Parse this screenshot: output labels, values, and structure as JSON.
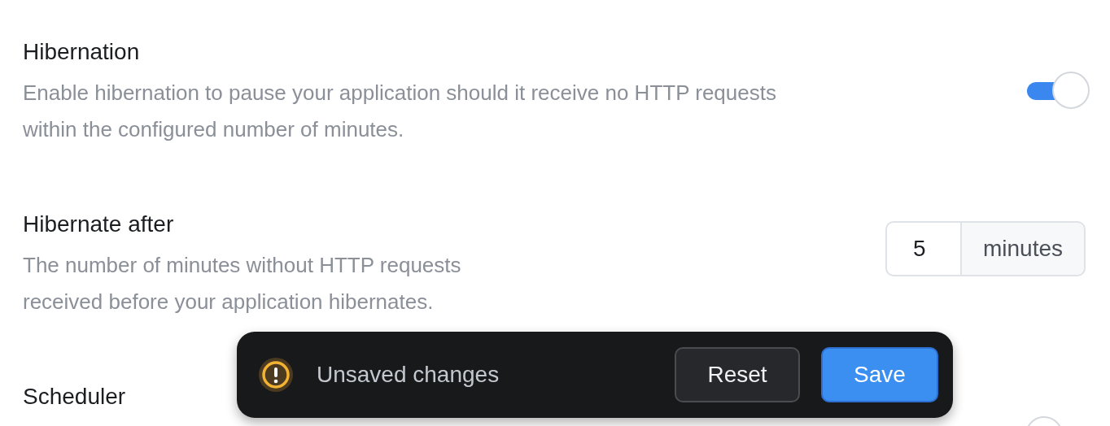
{
  "settings": [
    {
      "kind": "toggle",
      "title": "Hibernation",
      "description": "Enable hibernation to pause your application should it receive no HTTP requests within the configured number of minutes.",
      "on": true
    },
    {
      "kind": "number",
      "title": "Hibernate after",
      "description": "The number of minutes without HTTP requests received before your application hibernates.",
      "value": "5",
      "unit": "minutes"
    },
    {
      "kind": "toggle",
      "title": "Scheduler",
      "on": false
    }
  ],
  "toast": {
    "message": "Unsaved changes",
    "buttons": [
      {
        "kind": "secondary",
        "label": "Reset"
      },
      {
        "kind": "primary",
        "label": "Save"
      }
    ]
  }
}
